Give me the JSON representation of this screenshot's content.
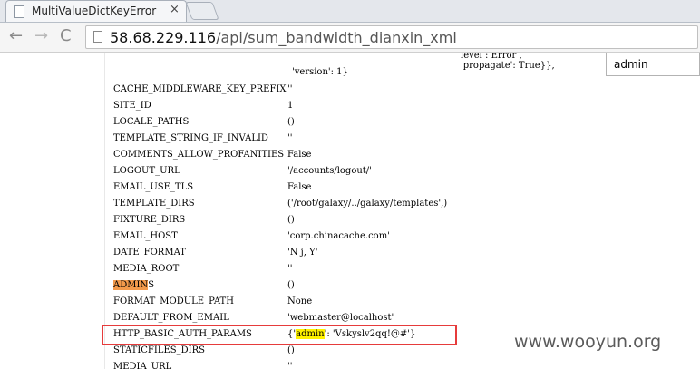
{
  "browser": {
    "tab_title": "MultiValueDictKeyError",
    "tab_close": "×",
    "url_host": "58.68.229.116",
    "url_path": "/api/sum_bandwidth_dianxin_xml",
    "find_query": "admin"
  },
  "page": {
    "overflow_line_1": "level : Error ,",
    "overflow_line_2": "'propagate': True}},",
    "version_line": "'version': 1}",
    "settings": [
      {
        "key": "CACHE_MIDDLEWARE_KEY_PREFIX",
        "value": "''"
      },
      {
        "key": "SITE_ID",
        "value": "1"
      },
      {
        "key": "LOCALE_PATHS",
        "value": "()"
      },
      {
        "key": "TEMPLATE_STRING_IF_INVALID",
        "value": "''"
      },
      {
        "key": "COMMENTS_ALLOW_PROFANITIES",
        "value": "False"
      },
      {
        "key": "LOGOUT_URL",
        "value": "'/accounts/logout/'"
      },
      {
        "key": "EMAIL_USE_TLS",
        "value": "False"
      },
      {
        "key": "TEMPLATE_DIRS",
        "value": "('/root/galaxy/../galaxy/templates',)"
      },
      {
        "key": "FIXTURE_DIRS",
        "value": "()"
      },
      {
        "key": "EMAIL_HOST",
        "value": "'corp.chinacache.com'"
      },
      {
        "key": "DATE_FORMAT",
        "value": "'N j, Y'"
      },
      {
        "key": "MEDIA_ROOT",
        "value": "''"
      },
      {
        "key_highlight": "ADMIN",
        "key_rest": "S",
        "value": "()"
      },
      {
        "key": "FORMAT_MODULE_PATH",
        "value": "None"
      },
      {
        "key": "DEFAULT_FROM_EMAIL",
        "value": "'webmaster@localhost'"
      },
      {
        "key": "HTTP_BASIC_AUTH_PARAMS",
        "value_pre": "{'",
        "value_highlight": "admin",
        "value_post": "': 'Vskyslv2qq!@#'}"
      },
      {
        "key": "STATICFILES_DIRS",
        "value": "()"
      },
      {
        "key": "MEDIA_URL",
        "value": "''"
      }
    ]
  },
  "watermark": "www.wooyun.org",
  "colors": {
    "highlight_orange": "#f39a4b",
    "highlight_yellow": "#fff200",
    "annotation_red": "#e63b3b"
  }
}
